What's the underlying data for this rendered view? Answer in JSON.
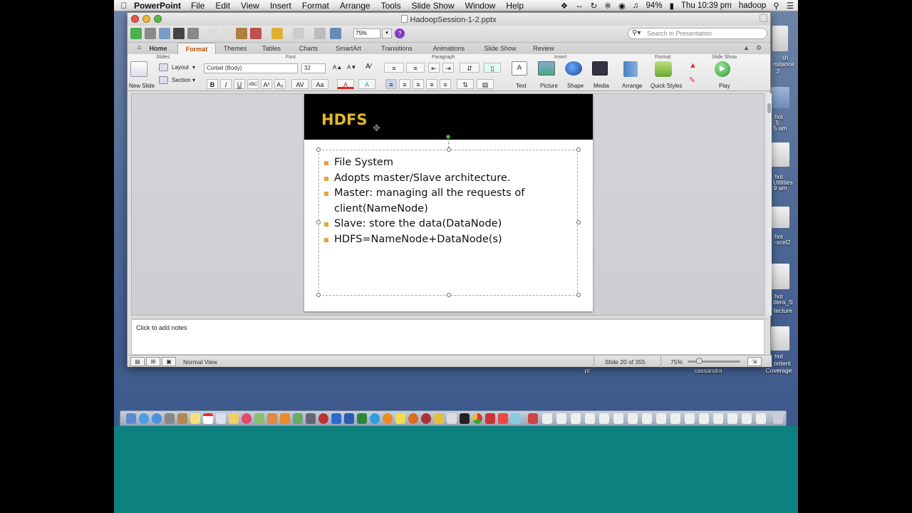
{
  "menubar": {
    "app": "PowerPoint",
    "items": [
      "File",
      "Edit",
      "View",
      "Insert",
      "Format",
      "Arrange",
      "Tools",
      "Slide Show",
      "Window",
      "Help"
    ],
    "battery": "94%",
    "clock": "Thu 10:39 pm",
    "user": "hadoop"
  },
  "window": {
    "title": "HadoopSession-1-2.pptx",
    "zoom": "75%",
    "search_placeholder": "Search in Presentation"
  },
  "tabs": [
    "Home",
    "Format",
    "Themes",
    "Tables",
    "Charts",
    "SmartArt",
    "Transitions",
    "Animations",
    "Slide Show",
    "Review"
  ],
  "active_tab": "Format",
  "ribbon": {
    "groups": [
      "Slides",
      "Font",
      "Paragraph",
      "Insert",
      "Format",
      "Slide Show"
    ],
    "new_slide": "New Slide",
    "layout": "Layout",
    "section": "Section",
    "font_name": "Corbel (Body)",
    "font_size": "32",
    "insert_items": [
      "Text",
      "Picture",
      "Shape",
      "Media"
    ],
    "format_items": [
      "Arrange",
      "Quick Styles"
    ],
    "play": "Play"
  },
  "slide": {
    "title": "HDFS",
    "bullets": [
      "File System",
      "Adopts master/Slave architecture.",
      "Master: managing all the requests of",
      "client(NameNode)",
      "Slave: store the data(DataNode)",
      "HDFS=NameNode+DataNode(s)"
    ]
  },
  "notes_placeholder": "Click to add notes",
  "status": {
    "view": "Normal View",
    "slide_counter": "Slide 20 of 355",
    "zoom": "75%"
  },
  "desktop": {
    "labels": [
      "sh",
      "nstance",
      "2",
      "hot",
      "5",
      "5 am",
      "hot",
      "Utilities",
      "9 am",
      "hot",
      "-xcel2",
      "hot",
      "dera_S",
      "tecture",
      "hot",
      "ontent",
      "Coverage",
      "cassandra",
      "pt"
    ]
  }
}
